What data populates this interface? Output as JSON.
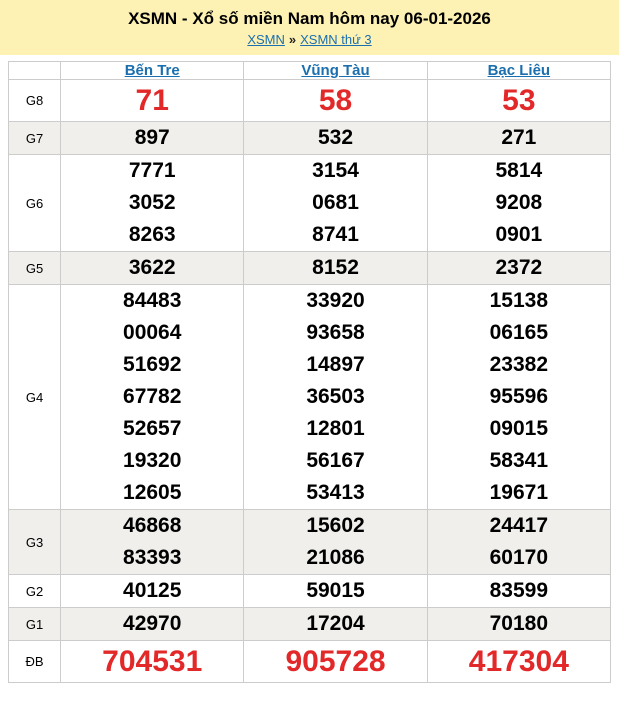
{
  "header": {
    "title": "XSMN - Xổ số miền Nam hôm nay 06-01-2026",
    "breadcrumb": {
      "links": [
        "XSMN",
        "XSMN thứ 3"
      ],
      "separator": "»"
    }
  },
  "table": {
    "columns": [
      "Bến Tre",
      "Vũng Tàu",
      "Bạc Liêu"
    ],
    "rows": [
      {
        "label": "G8",
        "highlight": true,
        "values": [
          [
            "71"
          ],
          [
            "58"
          ],
          [
            "53"
          ]
        ]
      },
      {
        "label": "G7",
        "highlight": false,
        "values": [
          [
            "897"
          ],
          [
            "532"
          ],
          [
            "271"
          ]
        ]
      },
      {
        "label": "G6",
        "highlight": false,
        "values": [
          [
            "7771",
            "3052",
            "8263"
          ],
          [
            "3154",
            "0681",
            "8741"
          ],
          [
            "5814",
            "9208",
            "0901"
          ]
        ]
      },
      {
        "label": "G5",
        "highlight": false,
        "values": [
          [
            "3622"
          ],
          [
            "8152"
          ],
          [
            "2372"
          ]
        ]
      },
      {
        "label": "G4",
        "highlight": false,
        "values": [
          [
            "84483",
            "00064",
            "51692",
            "67782",
            "52657",
            "19320",
            "12605"
          ],
          [
            "33920",
            "93658",
            "14897",
            "36503",
            "12801",
            "56167",
            "53413"
          ],
          [
            "15138",
            "06165",
            "23382",
            "95596",
            "09015",
            "58341",
            "19671"
          ]
        ]
      },
      {
        "label": "G3",
        "highlight": false,
        "values": [
          [
            "46868",
            "83393"
          ],
          [
            "15602",
            "21086"
          ],
          [
            "24417",
            "60170"
          ]
        ]
      },
      {
        "label": "G2",
        "highlight": false,
        "values": [
          [
            "40125"
          ],
          [
            "59015"
          ],
          [
            "83599"
          ]
        ]
      },
      {
        "label": "G1",
        "highlight": false,
        "values": [
          [
            "42970"
          ],
          [
            "17204"
          ],
          [
            "70180"
          ]
        ]
      },
      {
        "label": "ĐB",
        "highlight": true,
        "values": [
          [
            "704531"
          ],
          [
            "905728"
          ],
          [
            "417304"
          ]
        ]
      }
    ]
  },
  "colors": {
    "header_bg": "#FDF2B4",
    "row_alt_bg": "#F0EFEC",
    "border": "#CCCCCC",
    "link_blue": "#1B6FAE",
    "number_red": "#E22828",
    "text_black": "#000000"
  }
}
